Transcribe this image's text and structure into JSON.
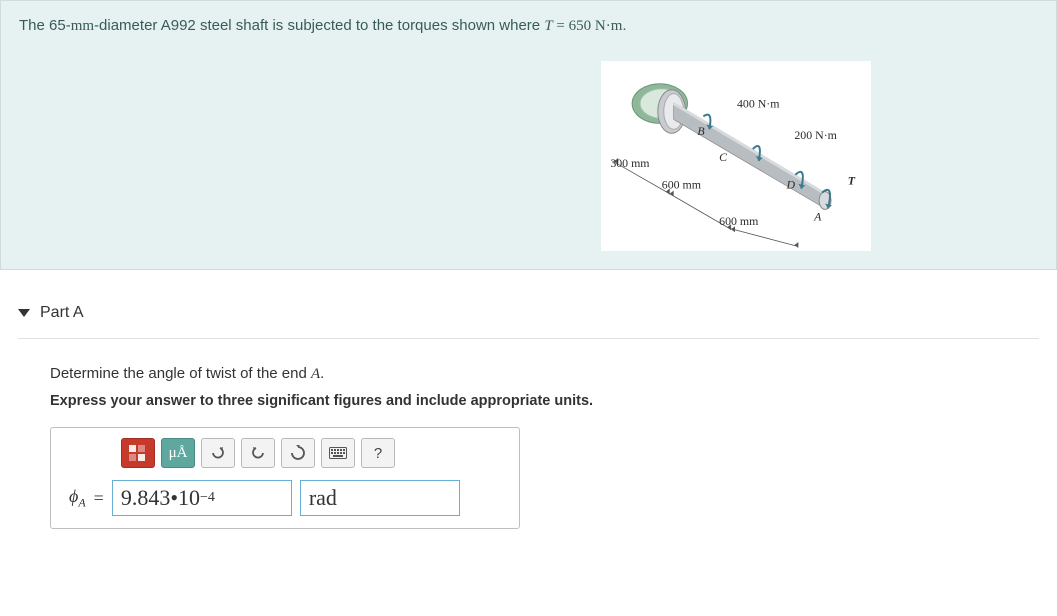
{
  "problem": {
    "text_prefix": "The 65-",
    "text_mm": "mm",
    "text_mid": "-diameter A992 steel shaft is subjected to the torques shown where ",
    "var_T": "T",
    "eq": " = ",
    "value_T": "650 N·m",
    "period": "."
  },
  "figure": {
    "labels": {
      "t400": "400 N·m",
      "t200": "200 N·m",
      "T": "T",
      "B": "B",
      "C": "C",
      "D": "D",
      "A": "A",
      "d300": "300 mm",
      "d600a": "600 mm",
      "d600b": "600 mm"
    }
  },
  "part": {
    "title": "Part A",
    "prompt_prefix": "Determine the angle of twist of the end ",
    "prompt_var": "A",
    "prompt_period": ".",
    "instruction": "Express your answer to three significant figures and include appropriate units."
  },
  "toolbar": {
    "units_label": "μÅ",
    "help_label": "?"
  },
  "answer": {
    "symbol": "ϕ",
    "subscript": "A",
    "equals": "=",
    "value_coeff": "9.843",
    "value_dot": " • ",
    "value_base": "10",
    "value_exp": "−4",
    "unit": "rad"
  }
}
